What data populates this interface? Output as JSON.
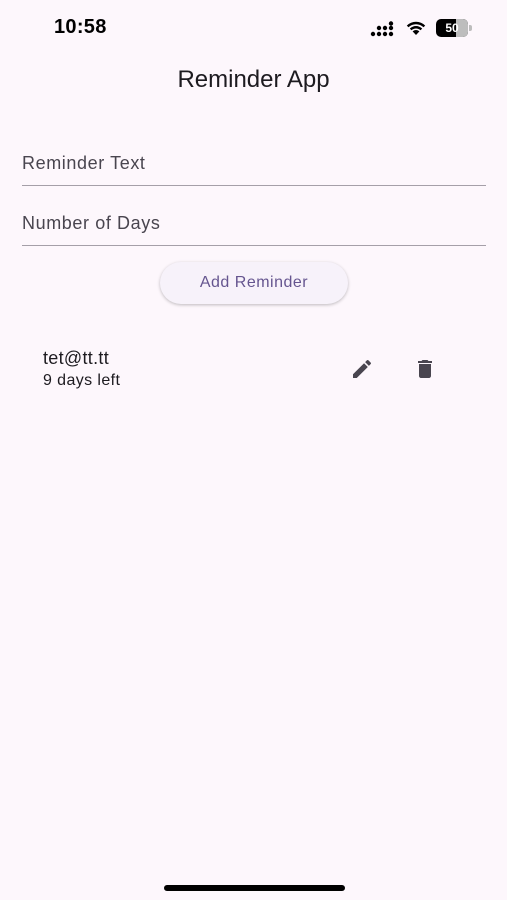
{
  "status_bar": {
    "time": "10:58",
    "battery_level": "50",
    "icons": [
      "signal-icon",
      "wifi-icon",
      "battery-icon"
    ]
  },
  "app": {
    "title": "Reminder App"
  },
  "form": {
    "reminder_text": {
      "value": "",
      "placeholder": "Reminder Text"
    },
    "number_of_days": {
      "value": "",
      "placeholder": "Number of Days"
    },
    "add_button_label": "Add Reminder"
  },
  "reminders": [
    {
      "text": "tet@tt.tt",
      "subtitle": "9 days left",
      "actions": [
        "edit-icon",
        "delete-icon"
      ]
    }
  ],
  "colors": {
    "background": "#fdf7fc",
    "accent": "#65558f",
    "divider": "#a59fa8"
  }
}
